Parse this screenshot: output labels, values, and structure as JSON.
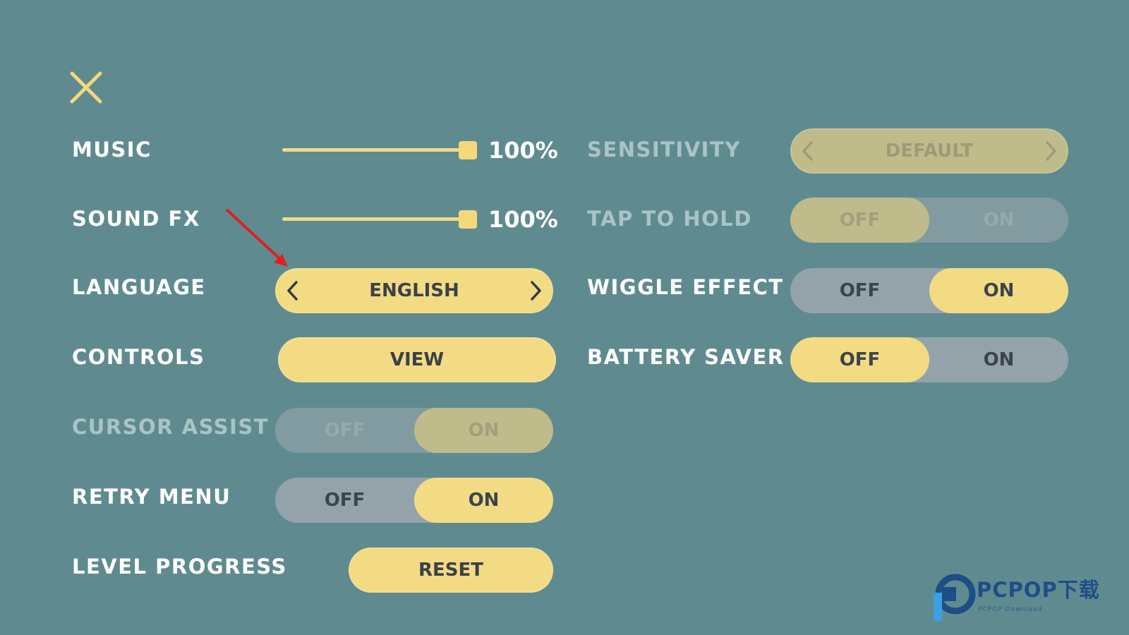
{
  "close": {
    "icon": "close-icon",
    "color": "#f3d97a"
  },
  "left_settings": {
    "music": {
      "label": "MUSIC",
      "value": "100%",
      "level": 1.0
    },
    "sound_fx": {
      "label": "SOUND FX",
      "value": "100%",
      "level": 1.0
    },
    "language": {
      "label": "LANGUAGE",
      "value": "ENGLISH"
    },
    "controls": {
      "label": "CONTROLS",
      "button": "VIEW"
    },
    "cursor_assist": {
      "label": "CURSOR ASSIST",
      "off": "OFF",
      "on": "ON",
      "selected": "on",
      "enabled": false
    },
    "retry_menu": {
      "label": "RETRY MENU",
      "off": "OFF",
      "on": "ON",
      "selected": "on",
      "enabled": true
    },
    "level_progress": {
      "label": "LEVEL PROGRESS",
      "button": "RESET"
    }
  },
  "right_settings": {
    "sensitivity": {
      "label": "SENSITIVITY",
      "value": "DEFAULT",
      "enabled": false
    },
    "tap_to_hold": {
      "label": "TAP TO HOLD",
      "off": "OFF",
      "on": "ON",
      "selected": "off",
      "enabled": false
    },
    "wiggle_effect": {
      "label": "WIGGLE EFFECT",
      "off": "OFF",
      "on": "ON",
      "selected": "on",
      "enabled": true
    },
    "battery_saver": {
      "label": "BATTERY SAVER",
      "off": "OFF",
      "on": "ON",
      "selected": "off",
      "enabled": true
    }
  },
  "colors": {
    "background": "#5f8b90",
    "accent_yellow": "#f3db84",
    "toggle_gray": "#94a3aa",
    "annotation_red": "#e02020"
  },
  "watermark": {
    "brand": "PCPOP下载",
    "sub": "PCPOP Download"
  }
}
